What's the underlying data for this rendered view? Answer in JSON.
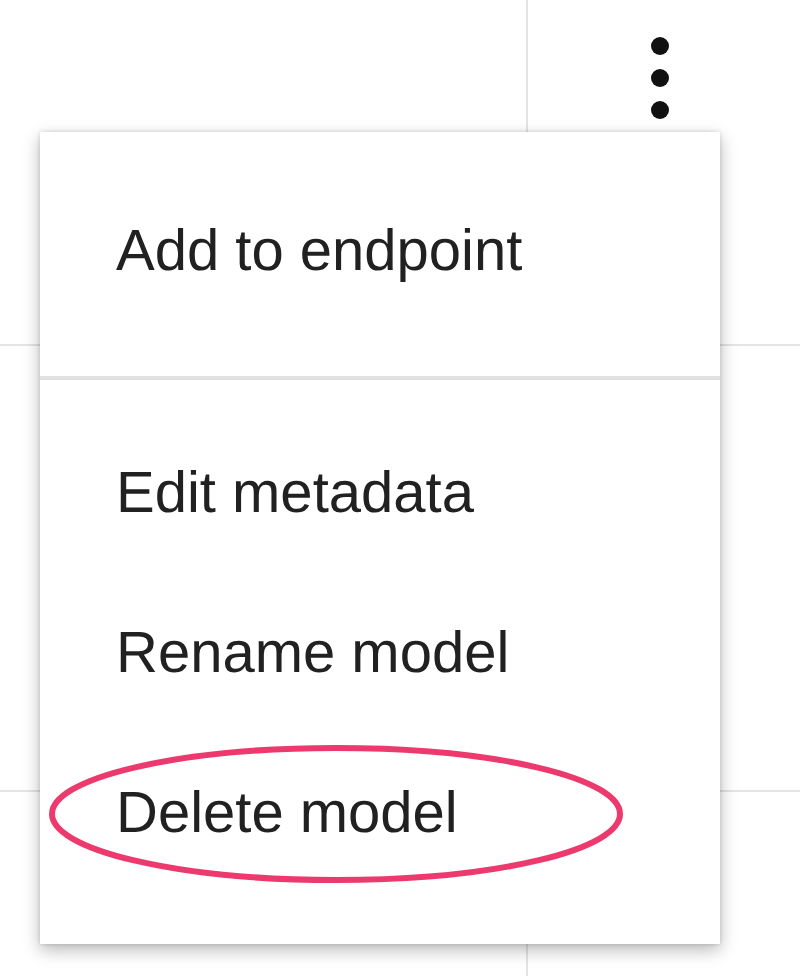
{
  "menu": {
    "groups": [
      {
        "items": [
          {
            "label": "Add to endpoint",
            "circled": false
          }
        ]
      },
      {
        "items": [
          {
            "label": "Edit metadata",
            "circled": false
          },
          {
            "label": "Rename model",
            "circled": false
          },
          {
            "label": "Delete model",
            "circled": true
          }
        ]
      }
    ]
  }
}
